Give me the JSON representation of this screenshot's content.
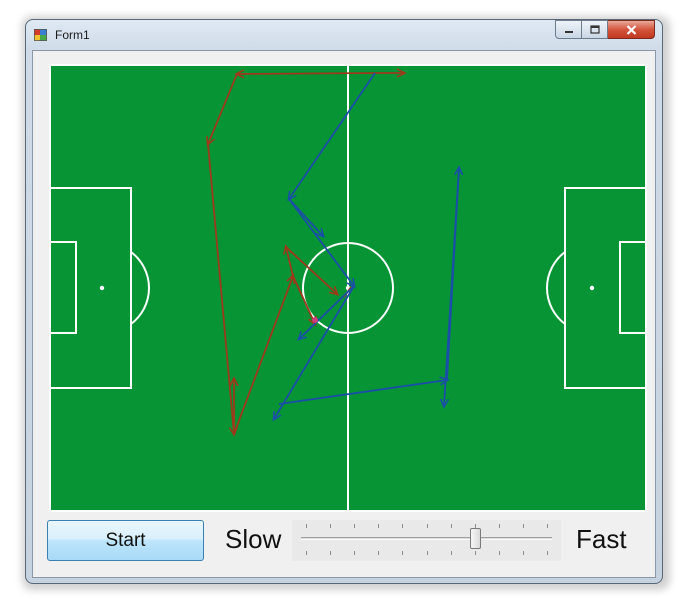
{
  "window": {
    "title": "Form1",
    "icon": "app-form-icon",
    "controls": {
      "minimize_icon": "minimize-icon",
      "maximize_icon": "maximize-icon",
      "close_icon": "close-icon"
    }
  },
  "field": {
    "grass_color": "#069435",
    "line_color": "#ffffff",
    "team_red_color": "#9c3a1c",
    "team_blue_color": "#1a4fa8"
  },
  "controls": {
    "start_label": "Start",
    "slow_label": "Slow",
    "fast_label": "Fast",
    "speed_slider": {
      "min": 0,
      "max": 10,
      "value": 7
    }
  }
}
